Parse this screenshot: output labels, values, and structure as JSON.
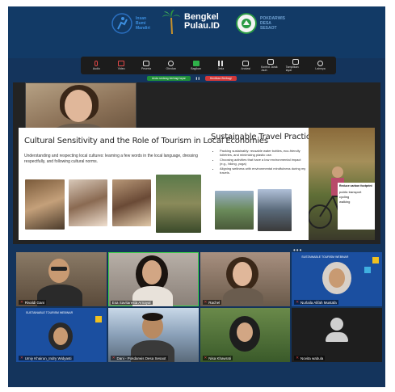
{
  "logos": {
    "logo1_text": "Insan\nBumi\nMandiri",
    "logo2_title": "Bengkel",
    "logo2_subtitle": "Pulau.ID",
    "logo3_text": "POKDARWIS\nDESA\nSESAOT"
  },
  "toolbar": {
    "items": [
      {
        "label": "Audio",
        "icon": "mic-muted-icon"
      },
      {
        "label": "Video",
        "icon": "camera-off-icon"
      },
      {
        "label": "Peserta",
        "icon": "participants-icon"
      },
      {
        "label": "Obrolan",
        "icon": "chat-icon"
      },
      {
        "label": "Bagikan",
        "icon": "share-icon"
      },
      {
        "label": "Jeda",
        "icon": "pause-icon"
      },
      {
        "label": "Anotasi",
        "icon": "annotate-icon"
      },
      {
        "label": "Kontrol Jarak Jauh",
        "icon": "remote-control-icon"
      },
      {
        "label": "Tampilkan layar",
        "icon": "screen-icon"
      },
      {
        "label": "Lainnya",
        "icon": "more-icon"
      }
    ],
    "share_status": "Anda sedang berbagi layar",
    "stop_label": "Hentikan Berbagi"
  },
  "slide": {
    "left_title": "Cultural Sensitivity and the Role of Tourism in Local Economies",
    "left_text": "Understanding and respecting local cultures: learning a few words in the local language, dressing respectfully, and following cultural norms.",
    "right_title": "Sustainable Travel Practices",
    "tips": [
      "Packing sustainably: reusable water bottles, eco-friendly toiletries, and minimizing plastic use.",
      "Choosing activities that have a low environmental impact (e.g., hiking, yoga)",
      "Aligning wellness with environmental mindfulness during my travels."
    ],
    "carbon_heading": "Reduce carbon footprint",
    "carbon_items": [
      "public transport",
      "cycling",
      "walking"
    ]
  },
  "participants": [
    {
      "name": "Rivaldi Gani",
      "active": false
    },
    {
      "name": "Esa Savitaresta Arnayal",
      "active": true
    },
    {
      "name": "Rachel",
      "active": false
    },
    {
      "name": "Nurlaila Alifah Mustafa",
      "active": false
    },
    {
      "name": "Umiy Khairun_Indry Widyasti",
      "active": false
    },
    {
      "name": "Dani - Pokdarwis Desa Sesaot",
      "active": false
    },
    {
      "name": "Nisa Khawrati",
      "active": false
    },
    {
      "name": "Novita wabula",
      "active": false
    }
  ],
  "banner_label": "SUSTAINABLE TOURISM WEBINAR",
  "colors": {
    "frame": "#14345c",
    "accent_green": "#3fcf4a",
    "stop_red": "#d33838"
  }
}
